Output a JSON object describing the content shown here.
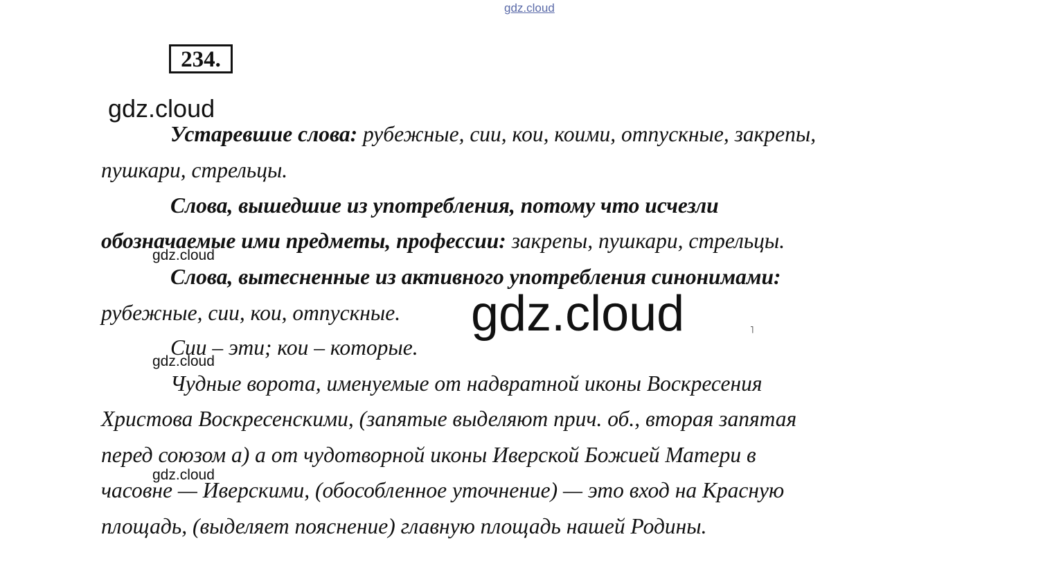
{
  "watermarks": {
    "top": "gdz.cloud",
    "upper_left": "gdz.cloud",
    "small_1": "gdz.cloud",
    "small_2": "gdz.cloud",
    "small_3": "gdz.cloud",
    "center_large": "gdz.cloud"
  },
  "exercise_number": "234.",
  "paragraphs": {
    "p1": {
      "heading": "Устаревшие слова:",
      "line1_rest": " рубежные, сии, кои, коими, отпускные, закрепы,",
      "line2": "пушкари, стрельцы."
    },
    "p2": {
      "line1": "Слова, вышедшие из употребления, потому что исчезли",
      "line2_bold": "обозначаемые ими предметы, профессии:",
      "line2_rest": " закрепы, пушкари, стрельцы."
    },
    "p3": {
      "line1": "Слова, вытесненные из активного употребления синонимами:",
      "line2": "рубежные, сии, кои, отпускные."
    },
    "p4": {
      "line1": "Сии – эти; кои – которые."
    },
    "p5": {
      "line1": "Чудные ворота, именуемые от надвратной иконы Воскресения",
      "line2": "Христова Воскресенскими, (запятые выделяют прич. об., вторая запятая",
      "line3": "перед союзом а) а от чудотворной иконы Иверской Божией Матери в",
      "line4": "часовне — Иверскими, (обособленное уточнение) — это вход на Красную",
      "line5": "площадь, (выделяет пояснение) главную площадь нашей Родины."
    }
  },
  "colors": {
    "text": "#111111",
    "watermark_link": "#5a6aa8"
  }
}
